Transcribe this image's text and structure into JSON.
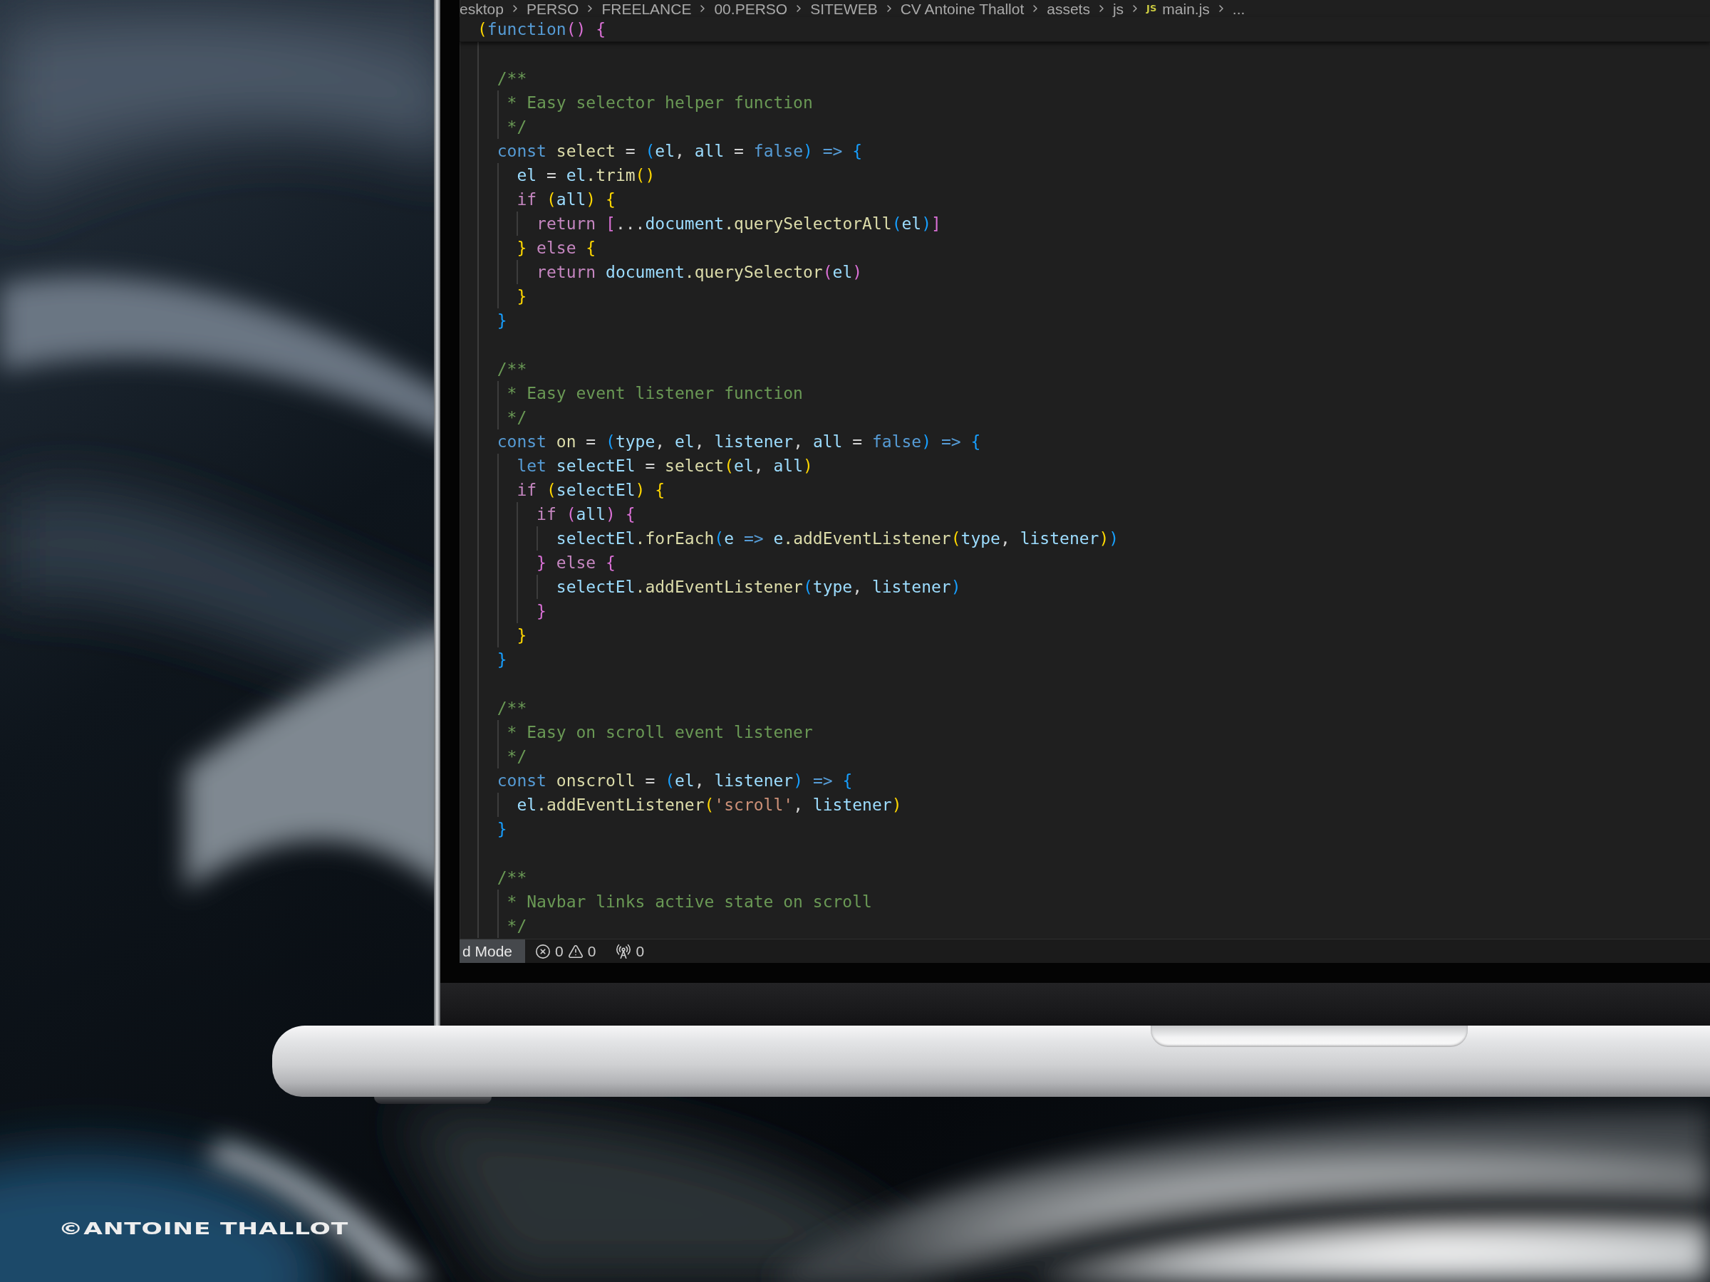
{
  "breadcrumb": [
    {
      "label": "esktop"
    },
    {
      "label": "PERSO"
    },
    {
      "label": "FREELANCE"
    },
    {
      "label": "00.PERSO"
    },
    {
      "label": "SITEWEB"
    },
    {
      "label": "CV Antoine Thallot"
    },
    {
      "label": "assets"
    },
    {
      "label": "js"
    },
    {
      "label": "main.js",
      "file_type": "JS"
    },
    {
      "label": "..."
    }
  ],
  "editor": {
    "sticky_line": {
      "tokens": [
        {
          "text": "(",
          "kind": "bracket-1"
        },
        {
          "text": "function",
          "kind": "storage"
        },
        {
          "text": "() {",
          "kind": "bracket-2"
        }
      ]
    },
    "lines": [
      {
        "kind": "blank"
      },
      {
        "kind": "code",
        "tokens": [
          {
            "text": "  /**",
            "kind": "comment"
          }
        ]
      },
      {
        "kind": "code",
        "tokens": [
          {
            "text": "   * Easy selector helper function",
            "kind": "comment"
          }
        ]
      },
      {
        "kind": "code",
        "tokens": [
          {
            "text": "   */",
            "kind": "comment"
          }
        ]
      },
      {
        "kind": "code",
        "tokens": [
          {
            "text": "  const ",
            "kind": "storage"
          },
          {
            "text": "select",
            "kind": "function"
          },
          {
            "text": " = ",
            "kind": "plain"
          },
          {
            "text": "(",
            "kind": "bracket-3"
          },
          {
            "text": "el",
            "kind": "variable"
          },
          {
            "text": ", ",
            "kind": "plain"
          },
          {
            "text": "all",
            "kind": "variable"
          },
          {
            "text": " = ",
            "kind": "plain"
          },
          {
            "text": "false",
            "kind": "storage"
          },
          {
            "text": ")",
            "kind": "bracket-3"
          },
          {
            "text": " => ",
            "kind": "storage"
          },
          {
            "text": "{",
            "kind": "bracket-3"
          }
        ]
      },
      {
        "kind": "code",
        "tokens": [
          {
            "text": "    el",
            "kind": "variable"
          },
          {
            "text": " = ",
            "kind": "plain"
          },
          {
            "text": "el",
            "kind": "variable"
          },
          {
            "text": ".trim",
            "kind": "function"
          },
          {
            "text": "()",
            "kind": "bracket-1"
          }
        ]
      },
      {
        "kind": "code",
        "tokens": [
          {
            "text": "    if ",
            "kind": "control"
          },
          {
            "text": "(",
            "kind": "bracket-1"
          },
          {
            "text": "all",
            "kind": "variable"
          },
          {
            "text": ") {",
            "kind": "bracket-1"
          }
        ]
      },
      {
        "kind": "code",
        "tokens": [
          {
            "text": "      return ",
            "kind": "control"
          },
          {
            "text": "[",
            "kind": "bracket-2"
          },
          {
            "text": "...",
            "kind": "plain"
          },
          {
            "text": "document",
            "kind": "variable"
          },
          {
            "text": ".querySelectorAll",
            "kind": "function"
          },
          {
            "text": "(",
            "kind": "bracket-3"
          },
          {
            "text": "el",
            "kind": "variable"
          },
          {
            "text": ")",
            "kind": "bracket-3"
          },
          {
            "text": "]",
            "kind": "bracket-2"
          }
        ]
      },
      {
        "kind": "code",
        "tokens": [
          {
            "text": "    }",
            "kind": "bracket-1"
          },
          {
            "text": " else ",
            "kind": "control"
          },
          {
            "text": "{",
            "kind": "bracket-1"
          }
        ]
      },
      {
        "kind": "code",
        "tokens": [
          {
            "text": "      return ",
            "kind": "control"
          },
          {
            "text": "document",
            "kind": "variable"
          },
          {
            "text": ".querySelector",
            "kind": "function"
          },
          {
            "text": "(",
            "kind": "bracket-2"
          },
          {
            "text": "el",
            "kind": "variable"
          },
          {
            "text": ")",
            "kind": "bracket-2"
          }
        ]
      },
      {
        "kind": "code",
        "tokens": [
          {
            "text": "    }",
            "kind": "bracket-1"
          }
        ]
      },
      {
        "kind": "code",
        "tokens": [
          {
            "text": "  }",
            "kind": "bracket-3"
          }
        ]
      },
      {
        "kind": "blank"
      },
      {
        "kind": "code",
        "tokens": [
          {
            "text": "  /**",
            "kind": "comment"
          }
        ]
      },
      {
        "kind": "code",
        "tokens": [
          {
            "text": "   * Easy event listener function",
            "kind": "comment"
          }
        ]
      },
      {
        "kind": "code",
        "tokens": [
          {
            "text": "   */",
            "kind": "comment"
          }
        ]
      },
      {
        "kind": "code",
        "tokens": [
          {
            "text": "  const ",
            "kind": "storage"
          },
          {
            "text": "on",
            "kind": "function"
          },
          {
            "text": " = ",
            "kind": "plain"
          },
          {
            "text": "(",
            "kind": "bracket-3"
          },
          {
            "text": "type",
            "kind": "variable"
          },
          {
            "text": ", ",
            "kind": "plain"
          },
          {
            "text": "el",
            "kind": "variable"
          },
          {
            "text": ", ",
            "kind": "plain"
          },
          {
            "text": "listener",
            "kind": "variable"
          },
          {
            "text": ", ",
            "kind": "plain"
          },
          {
            "text": "all",
            "kind": "variable"
          },
          {
            "text": " = ",
            "kind": "plain"
          },
          {
            "text": "false",
            "kind": "storage"
          },
          {
            "text": ")",
            "kind": "bracket-3"
          },
          {
            "text": " => ",
            "kind": "storage"
          },
          {
            "text": "{",
            "kind": "bracket-3"
          }
        ]
      },
      {
        "kind": "code",
        "tokens": [
          {
            "text": "    let ",
            "kind": "storage"
          },
          {
            "text": "selectEl",
            "kind": "variable"
          },
          {
            "text": " = ",
            "kind": "plain"
          },
          {
            "text": "select",
            "kind": "function"
          },
          {
            "text": "(",
            "kind": "bracket-1"
          },
          {
            "text": "el",
            "kind": "variable"
          },
          {
            "text": ", ",
            "kind": "plain"
          },
          {
            "text": "all",
            "kind": "variable"
          },
          {
            "text": ")",
            "kind": "bracket-1"
          }
        ]
      },
      {
        "kind": "code",
        "tokens": [
          {
            "text": "    if ",
            "kind": "control"
          },
          {
            "text": "(",
            "kind": "bracket-1"
          },
          {
            "text": "selectEl",
            "kind": "variable"
          },
          {
            "text": ") {",
            "kind": "bracket-1"
          }
        ]
      },
      {
        "kind": "code",
        "tokens": [
          {
            "text": "      if ",
            "kind": "control"
          },
          {
            "text": "(",
            "kind": "bracket-2"
          },
          {
            "text": "all",
            "kind": "variable"
          },
          {
            "text": ") {",
            "kind": "bracket-2"
          }
        ]
      },
      {
        "kind": "code",
        "tokens": [
          {
            "text": "        selectEl",
            "kind": "variable"
          },
          {
            "text": ".forEach",
            "kind": "function"
          },
          {
            "text": "(",
            "kind": "bracket-3"
          },
          {
            "text": "e",
            "kind": "variable"
          },
          {
            "text": " => ",
            "kind": "storage"
          },
          {
            "text": "e",
            "kind": "variable"
          },
          {
            "text": ".addEventListener",
            "kind": "function"
          },
          {
            "text": "(",
            "kind": "bracket-1"
          },
          {
            "text": "type",
            "kind": "variable"
          },
          {
            "text": ", ",
            "kind": "plain"
          },
          {
            "text": "listener",
            "kind": "variable"
          },
          {
            "text": ")",
            "kind": "bracket-1"
          },
          {
            "text": ")",
            "kind": "bracket-3"
          }
        ]
      },
      {
        "kind": "code",
        "tokens": [
          {
            "text": "      }",
            "kind": "bracket-2"
          },
          {
            "text": " else ",
            "kind": "control"
          },
          {
            "text": "{",
            "kind": "bracket-2"
          }
        ]
      },
      {
        "kind": "code",
        "tokens": [
          {
            "text": "        selectEl",
            "kind": "variable"
          },
          {
            "text": ".addEventListener",
            "kind": "function"
          },
          {
            "text": "(",
            "kind": "bracket-3"
          },
          {
            "text": "type",
            "kind": "variable"
          },
          {
            "text": ", ",
            "kind": "plain"
          },
          {
            "text": "listener",
            "kind": "variable"
          },
          {
            "text": ")",
            "kind": "bracket-3"
          }
        ]
      },
      {
        "kind": "code",
        "tokens": [
          {
            "text": "      }",
            "kind": "bracket-2"
          }
        ]
      },
      {
        "kind": "code",
        "tokens": [
          {
            "text": "    }",
            "kind": "bracket-1"
          }
        ]
      },
      {
        "kind": "code",
        "tokens": [
          {
            "text": "  }",
            "kind": "bracket-3"
          }
        ]
      },
      {
        "kind": "blank"
      },
      {
        "kind": "code",
        "tokens": [
          {
            "text": "  /**",
            "kind": "comment"
          }
        ]
      },
      {
        "kind": "code",
        "tokens": [
          {
            "text": "   * Easy on scroll event listener",
            "kind": "comment"
          }
        ]
      },
      {
        "kind": "code",
        "tokens": [
          {
            "text": "   */",
            "kind": "comment"
          }
        ]
      },
      {
        "kind": "code",
        "tokens": [
          {
            "text": "  const ",
            "kind": "storage"
          },
          {
            "text": "onscroll",
            "kind": "function"
          },
          {
            "text": " = ",
            "kind": "plain"
          },
          {
            "text": "(",
            "kind": "bracket-3"
          },
          {
            "text": "el",
            "kind": "variable"
          },
          {
            "text": ", ",
            "kind": "plain"
          },
          {
            "text": "listener",
            "kind": "variable"
          },
          {
            "text": ")",
            "kind": "bracket-3"
          },
          {
            "text": " => ",
            "kind": "storage"
          },
          {
            "text": "{",
            "kind": "bracket-3"
          }
        ]
      },
      {
        "kind": "code",
        "tokens": [
          {
            "text": "    el",
            "kind": "variable"
          },
          {
            "text": ".addEventListener",
            "kind": "function"
          },
          {
            "text": "(",
            "kind": "bracket-1"
          },
          {
            "text": "'scroll'",
            "kind": "string"
          },
          {
            "text": ", ",
            "kind": "plain"
          },
          {
            "text": "listener",
            "kind": "variable"
          },
          {
            "text": ")",
            "kind": "bracket-1"
          }
        ]
      },
      {
        "kind": "code",
        "tokens": [
          {
            "text": "  }",
            "kind": "bracket-3"
          }
        ]
      },
      {
        "kind": "blank"
      },
      {
        "kind": "code",
        "tokens": [
          {
            "text": "  /**",
            "kind": "comment"
          }
        ]
      },
      {
        "kind": "code",
        "tokens": [
          {
            "text": "   * Navbar links active state on scroll",
            "kind": "comment"
          }
        ]
      },
      {
        "kind": "code",
        "tokens": [
          {
            "text": "   */",
            "kind": "comment"
          }
        ]
      }
    ]
  },
  "status_bar": {
    "mode": "d Mode",
    "errors": "0",
    "warnings": "0",
    "ports": "0"
  },
  "credit": "©ANTOINE THALLOT"
}
